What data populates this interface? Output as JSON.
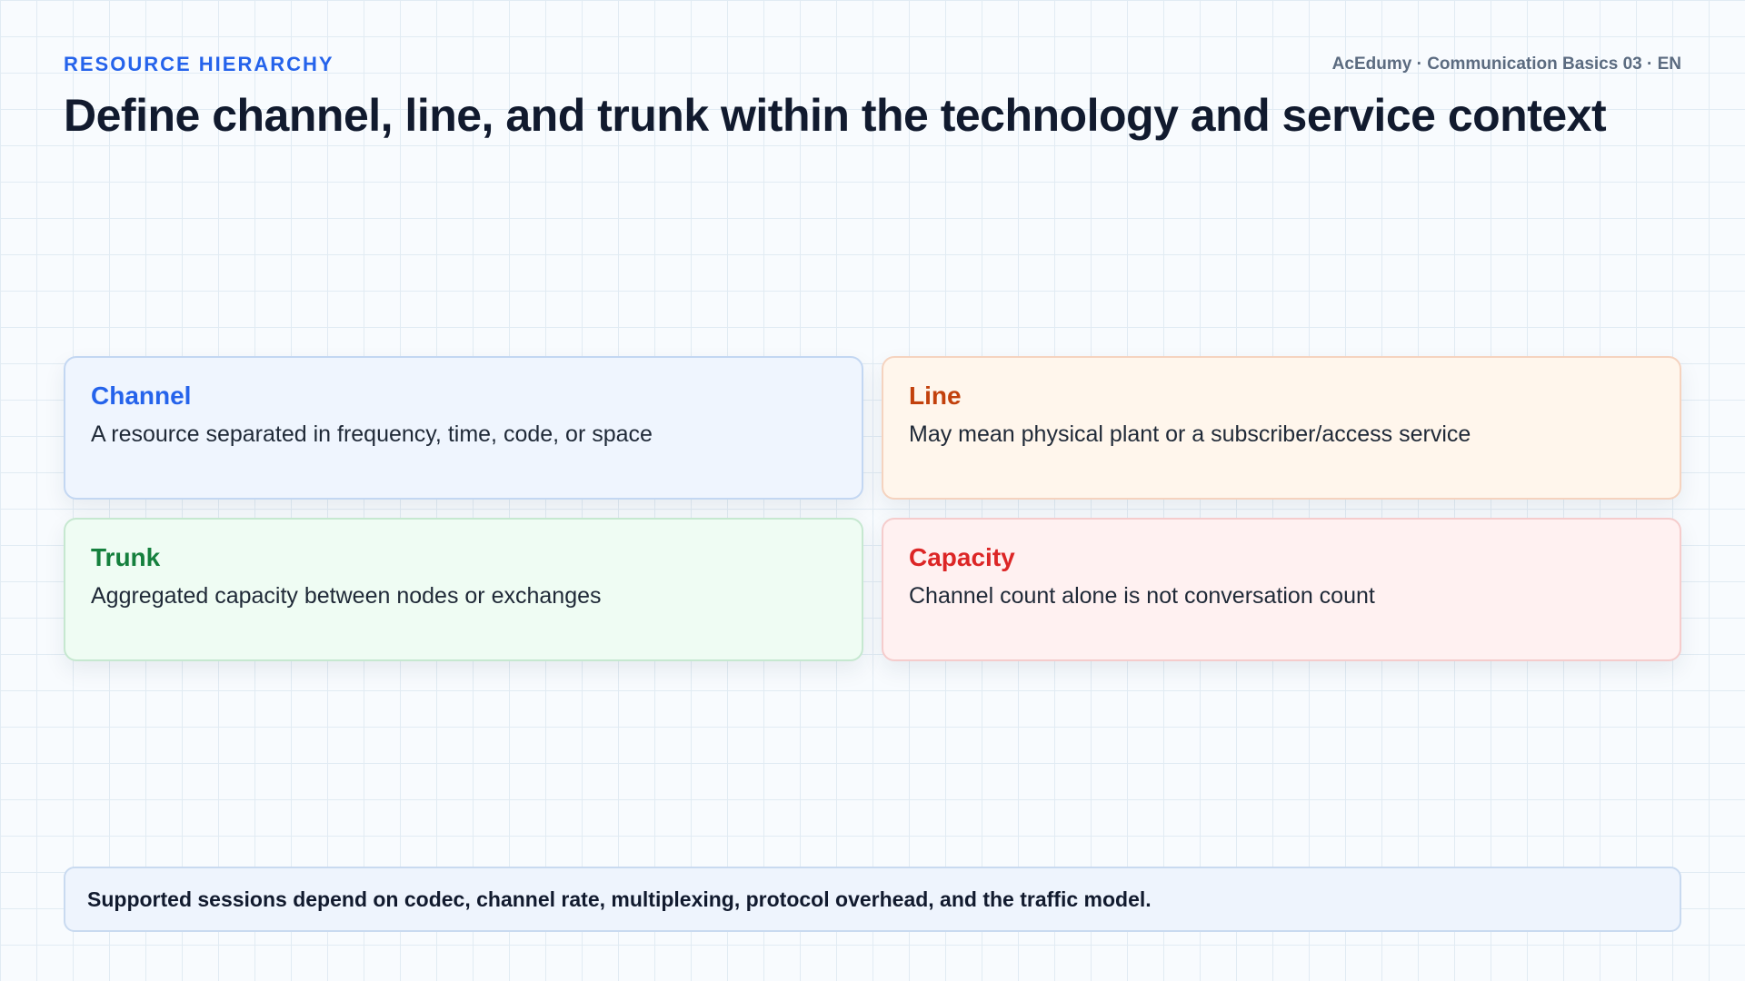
{
  "header": {
    "eyebrow": "RESOURCE HIERARCHY",
    "course_tag": "AcEdumy · Communication Basics 03 · EN",
    "title": "Define channel, line, and trunk within the technology and service context"
  },
  "cards": [
    {
      "title": "Channel",
      "text": "A resource separated in frequency, time, code, or space",
      "accent": "#2563eb",
      "background": "#eff5fe",
      "border": "#c3d7f2"
    },
    {
      "title": "Line",
      "text": "May mean physical plant or a subscriber/access service",
      "accent": "#c2410c",
      "background": "#fff6ec",
      "border": "#f5d3bf"
    },
    {
      "title": "Trunk",
      "text": "Aggregated capacity between nodes or exchanges",
      "accent": "#15803d",
      "background": "#effcf3",
      "border": "#c6e8d0"
    },
    {
      "title": "Capacity",
      "text": "Channel count alone is not conversation count",
      "accent": "#dc2626",
      "background": "#fff1f1",
      "border": "#f5cccc"
    }
  ],
  "footer": {
    "text": "Supported sessions depend on codec, channel rate, multiplexing, protocol overhead, and the traffic model."
  }
}
